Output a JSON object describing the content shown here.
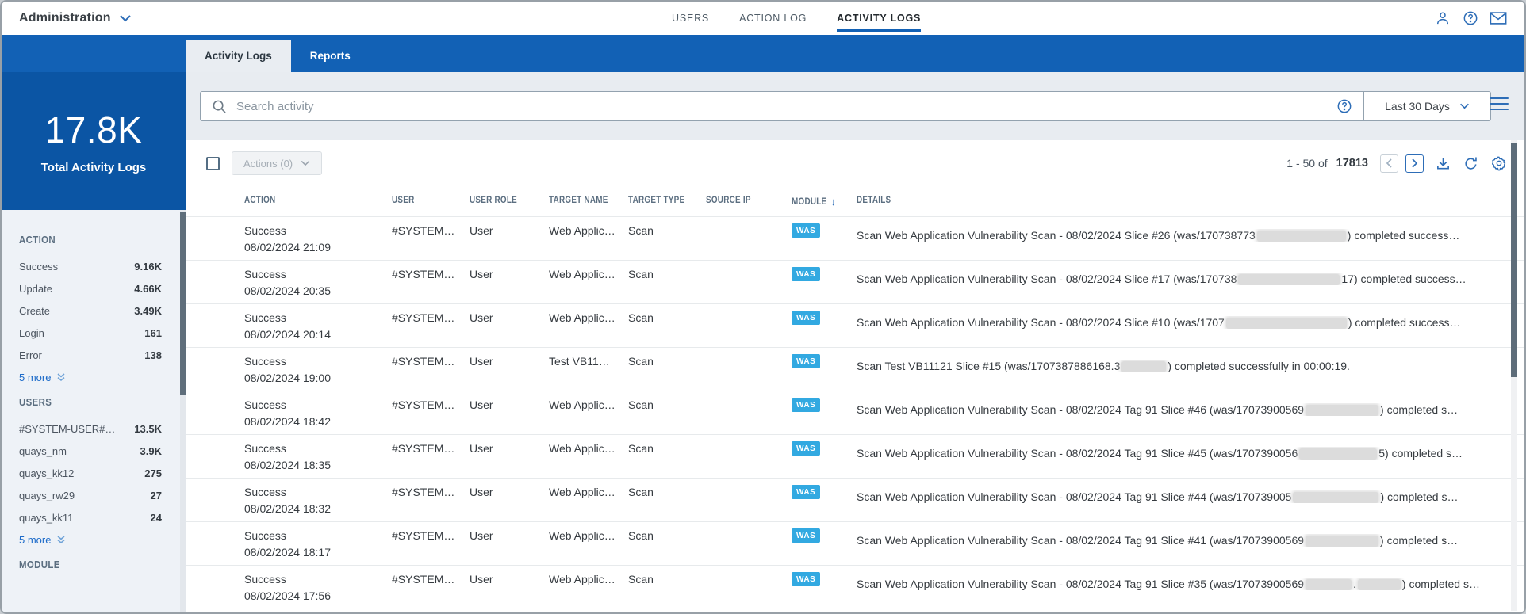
{
  "topbar": {
    "app_menu": "Administration",
    "nav": [
      {
        "label": "USERS",
        "active": false
      },
      {
        "label": "ACTION LOG",
        "active": false
      },
      {
        "label": "ACTIVITY LOGS",
        "active": true
      }
    ]
  },
  "tabs": [
    {
      "label": "Activity Logs",
      "active": true
    },
    {
      "label": "Reports",
      "active": false
    }
  ],
  "search": {
    "placeholder": "Search activity",
    "date_range": "Last 30 Days"
  },
  "sidebar": {
    "stat": {
      "value": "17.8K",
      "label": "Total Activity Logs"
    },
    "sections": [
      {
        "title": "ACTION",
        "items": [
          {
            "label": "Success",
            "value": "9.16K"
          },
          {
            "label": "Update",
            "value": "4.66K"
          },
          {
            "label": "Create",
            "value": "3.49K"
          },
          {
            "label": "Login",
            "value": "161"
          },
          {
            "label": "Error",
            "value": "138"
          }
        ],
        "more": "5 more"
      },
      {
        "title": "USERS",
        "items": [
          {
            "label": "#SYSTEM-USER#…",
            "value": "13.5K"
          },
          {
            "label": "quays_nm",
            "value": "3.9K"
          },
          {
            "label": "quays_kk12",
            "value": "275"
          },
          {
            "label": "quays_rw29",
            "value": "27"
          },
          {
            "label": "quays_kk11",
            "value": "24"
          }
        ],
        "more": "5 more"
      },
      {
        "title": "MODULE",
        "items": [],
        "more": ""
      }
    ]
  },
  "toolbar": {
    "actions_label": "Actions (0)",
    "pagination": {
      "range": "1 - 50 of",
      "total": "17813"
    }
  },
  "table": {
    "columns": [
      "ACTION",
      "USER",
      "USER ROLE",
      "TARGET NAME",
      "TARGET TYPE",
      "SOURCE IP",
      "MODULE",
      "DETAILS"
    ],
    "sorted_by": "MODULE",
    "rows": [
      {
        "action": "Success",
        "timestamp": "08/02/2024 21:09",
        "user": "#SYSTEM…",
        "user_role": "User",
        "target_name": "Web Applic…",
        "target_type": "Scan",
        "source_ip": "",
        "module": "WAS",
        "details": [
          {
            "text": "Scan Web Application Vulnerability Scan - 08/02/2024 Slice #26 (was/170738773"
          },
          {
            "redact": 112
          },
          {
            "text": ") completed success…"
          }
        ]
      },
      {
        "action": "Success",
        "timestamp": "08/02/2024 20:35",
        "user": "#SYSTEM…",
        "user_role": "User",
        "target_name": "Web Applic…",
        "target_type": "Scan",
        "source_ip": "",
        "module": "WAS",
        "details": [
          {
            "text": "Scan Web Application Vulnerability Scan - 08/02/2024 Slice #17 (was/170738"
          },
          {
            "redact": 128
          },
          {
            "text": "17) completed success…"
          }
        ]
      },
      {
        "action": "Success",
        "timestamp": "08/02/2024 20:14",
        "user": "#SYSTEM…",
        "user_role": "User",
        "target_name": "Web Applic…",
        "target_type": "Scan",
        "source_ip": "",
        "module": "WAS",
        "details": [
          {
            "text": "Scan Web Application Vulnerability Scan - 08/02/2024 Slice #10 (was/1707"
          },
          {
            "redact": 152
          },
          {
            "text": ") completed success…"
          }
        ]
      },
      {
        "action": "Success",
        "timestamp": "08/02/2024 19:00",
        "user": "#SYSTEM…",
        "user_role": "User",
        "target_name": "Test VB11…",
        "target_type": "Scan",
        "source_ip": "",
        "module": "WAS",
        "details": [
          {
            "text": "Scan Test VB11121 Slice #15 (was/1707387886168.3"
          },
          {
            "redact": 56
          },
          {
            "text": ") completed successfully in 00:00:19."
          }
        ]
      },
      {
        "action": "Success",
        "timestamp": "08/02/2024 18:42",
        "user": "#SYSTEM…",
        "user_role": "User",
        "target_name": "Web Applic…",
        "target_type": "Scan",
        "source_ip": "",
        "module": "WAS",
        "details": [
          {
            "text": "Scan Web Application Vulnerability Scan - 08/02/2024 Tag 91 Slice #46 (was/17073900569"
          },
          {
            "redact": 92
          },
          {
            "text": ") completed s…"
          }
        ]
      },
      {
        "action": "Success",
        "timestamp": "08/02/2024 18:35",
        "user": "#SYSTEM…",
        "user_role": "User",
        "target_name": "Web Applic…",
        "target_type": "Scan",
        "source_ip": "",
        "module": "WAS",
        "details": [
          {
            "text": "Scan Web Application Vulnerability Scan - 08/02/2024 Tag 91 Slice #45 (was/1707390056"
          },
          {
            "redact": 98
          },
          {
            "text": "5) completed s…"
          }
        ]
      },
      {
        "action": "Success",
        "timestamp": "08/02/2024 18:32",
        "user": "#SYSTEM…",
        "user_role": "User",
        "target_name": "Web Applic…",
        "target_type": "Scan",
        "source_ip": "",
        "module": "WAS",
        "details": [
          {
            "text": "Scan Web Application Vulnerability Scan - 08/02/2024 Tag 91 Slice #44 (was/170739005"
          },
          {
            "redact": 108
          },
          {
            "text": ") completed s…"
          }
        ]
      },
      {
        "action": "Success",
        "timestamp": "08/02/2024 18:17",
        "user": "#SYSTEM…",
        "user_role": "User",
        "target_name": "Web Applic…",
        "target_type": "Scan",
        "source_ip": "",
        "module": "WAS",
        "details": [
          {
            "text": "Scan Web Application Vulnerability Scan - 08/02/2024 Tag 91 Slice #41 (was/17073900569"
          },
          {
            "redact": 92
          },
          {
            "text": ") completed s…"
          }
        ]
      },
      {
        "action": "Success",
        "timestamp": "08/02/2024 17:56",
        "user": "#SYSTEM…",
        "user_role": "User",
        "target_name": "Web Applic…",
        "target_type": "Scan",
        "source_ip": "",
        "module": "WAS",
        "details": [
          {
            "text": "Scan Web Application Vulnerability Scan - 08/02/2024 Tag 91 Slice #35 (was/17073900569"
          },
          {
            "redact": 58
          },
          {
            "text": "."
          },
          {
            "redact": 54
          },
          {
            "text": ") completed s…"
          }
        ]
      }
    ]
  },
  "colors": {
    "band_blue": "#1261b5",
    "panel_blue": "#0b55a4",
    "badge_blue": "#32a9e1",
    "link_blue": "#1b6ac9"
  }
}
